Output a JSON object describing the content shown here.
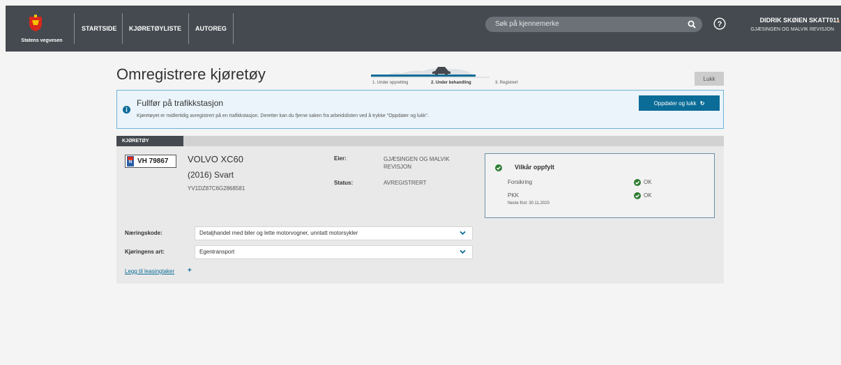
{
  "header": {
    "logo_text": "Statens vegvesen",
    "nav": [
      "STARTSIDE",
      "KJØRETØYLISTE",
      "AUTOREG"
    ],
    "search_placeholder": "Søk på kjennemerke",
    "user_name": "DIDRIK SKØIEN SKATT011",
    "user_org": "GJÆSINGEN OG MALVIK REVISJON"
  },
  "page": {
    "title": "Omregistrere kjøretøy",
    "close_label": "Lukk",
    "steps": [
      "1. Under oppretting",
      "2. Under behandling",
      "3. Registrert"
    ],
    "active_step": 2
  },
  "info": {
    "title": "Fullfør på trafikkstasjon",
    "text": "Kjøretøyet er midlertidig avregistrert på en trafikkstasjon. Deretter kan du fjerne saken fra arbeidslisten ved å trykke \"Oppdater og lukk\".",
    "button_label": "Oppdater og lukk"
  },
  "vehicle": {
    "tab_label": "KJØRETØY",
    "plate_flag": "N",
    "plate": "VH 79867",
    "model": "VOLVO XC60",
    "year_color": "(2016) Svart",
    "vin": "YV1DZ87C6G2868581",
    "owner_label": "Eier:",
    "owner_value": "GJÆSINGEN OG MALVIK REVISJON",
    "status_label": "Status:",
    "status_value": "AVREGISTRERT"
  },
  "conditions": {
    "title": "Vilkår oppfylt",
    "items": [
      {
        "label": "Forsikring",
        "status": "OK"
      },
      {
        "label": "PKK",
        "status": "OK",
        "note": "Neste frist: 30.11.2020"
      }
    ]
  },
  "form": {
    "industry_label": "Næringskode:",
    "industry_value": "Detaljhandel med biler og lette motorvogner, unntatt motorsykler",
    "driving_label": "Kjøringens art:",
    "driving_value": "Egentransport",
    "lease_link": "Legg til leasingtaker"
  },
  "colors": {
    "header_bg": "#444a4f",
    "accent_blue": "#0a6c97",
    "ok_green": "#2e7d32",
    "brand_orange": "#f36f21",
    "info_border": "#6fb3d8"
  }
}
